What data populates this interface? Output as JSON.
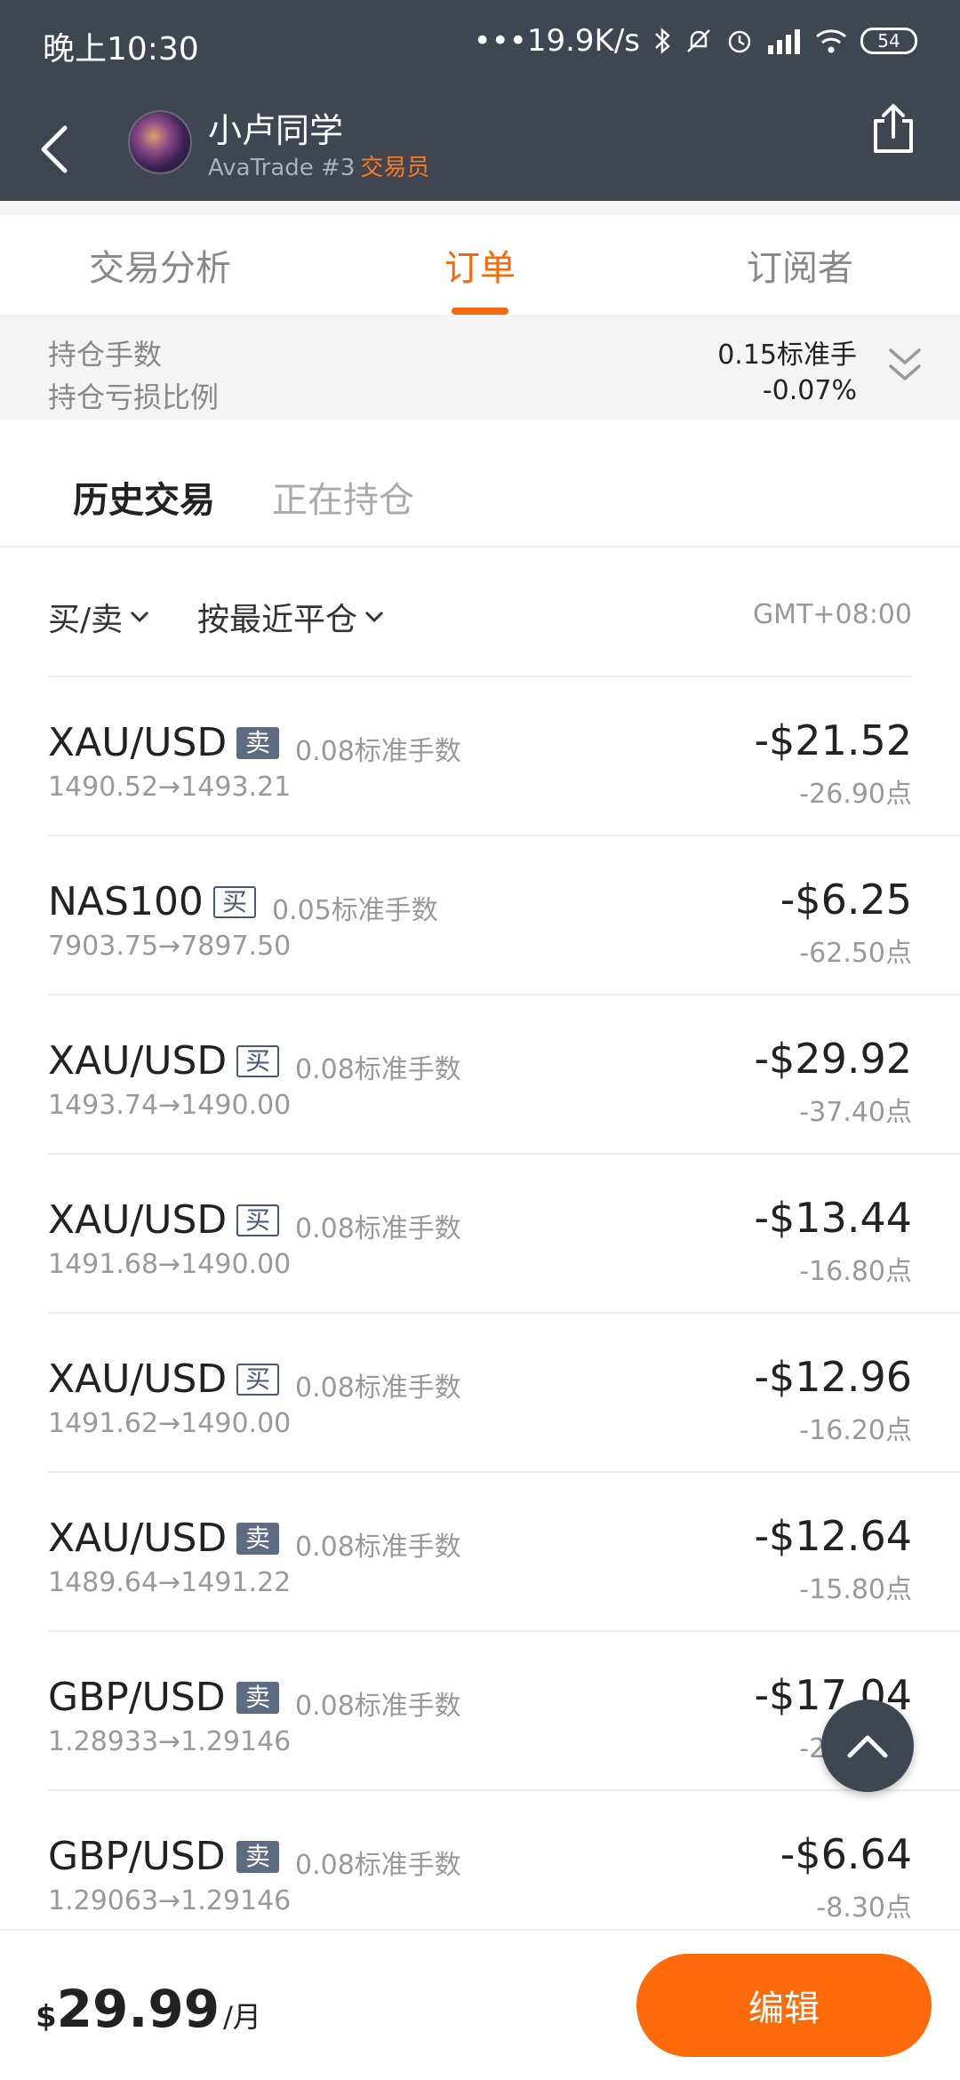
{
  "status": {
    "time": "晚上10:30",
    "speed": "•••19.9K/s",
    "battery": "54"
  },
  "header": {
    "name": "小卢同学",
    "broker": "AvaTrade #3",
    "role": "交易员"
  },
  "tabs": [
    "交易分析",
    "订单",
    "订阅者"
  ],
  "summary": {
    "positions_label": "持仓手数",
    "positions_value": "0.15标准手",
    "pl_ratio_label": "持仓亏损比例",
    "pl_ratio_value": "-0.07%"
  },
  "subtabs": {
    "history": "历史交易",
    "holding": "正在持仓"
  },
  "filters": {
    "side": "买/卖",
    "sort": "按最近平仓",
    "timezone": "GMT+08:00"
  },
  "trades": [
    {
      "symbol": "XAU/USD",
      "side": "卖",
      "side_type": "sell",
      "lots": "0.08标准手数",
      "range": "1490.52→1493.21",
      "pnl": "-$21.52",
      "points": "-26.90点"
    },
    {
      "symbol": "NAS100",
      "side": "买",
      "side_type": "buy",
      "lots": "0.05标准手数",
      "range": "7903.75→7897.50",
      "pnl": "-$6.25",
      "points": "-62.50点"
    },
    {
      "symbol": "XAU/USD",
      "side": "买",
      "side_type": "buy",
      "lots": "0.08标准手数",
      "range": "1493.74→1490.00",
      "pnl": "-$29.92",
      "points": "-37.40点"
    },
    {
      "symbol": "XAU/USD",
      "side": "买",
      "side_type": "buy",
      "lots": "0.08标准手数",
      "range": "1491.68→1490.00",
      "pnl": "-$13.44",
      "points": "-16.80点"
    },
    {
      "symbol": "XAU/USD",
      "side": "买",
      "side_type": "buy",
      "lots": "0.08标准手数",
      "range": "1491.62→1490.00",
      "pnl": "-$12.96",
      "points": "-16.20点"
    },
    {
      "symbol": "XAU/USD",
      "side": "卖",
      "side_type": "sell",
      "lots": "0.08标准手数",
      "range": "1489.64→1491.22",
      "pnl": "-$12.64",
      "points": "-15.80点"
    },
    {
      "symbol": "GBP/USD",
      "side": "卖",
      "side_type": "sell",
      "lots": "0.08标准手数",
      "range": "1.28933→1.29146",
      "pnl": "-$17.04",
      "points": "-21.30点"
    },
    {
      "symbol": "GBP/USD",
      "side": "卖",
      "side_type": "sell",
      "lots": "0.08标准手数",
      "range": "1.29063→1.29146",
      "pnl": "-$6.64",
      "points": "-8.30点"
    }
  ],
  "footer": {
    "currency": "$",
    "price": "29.99",
    "period": "/月",
    "edit": "编辑"
  }
}
